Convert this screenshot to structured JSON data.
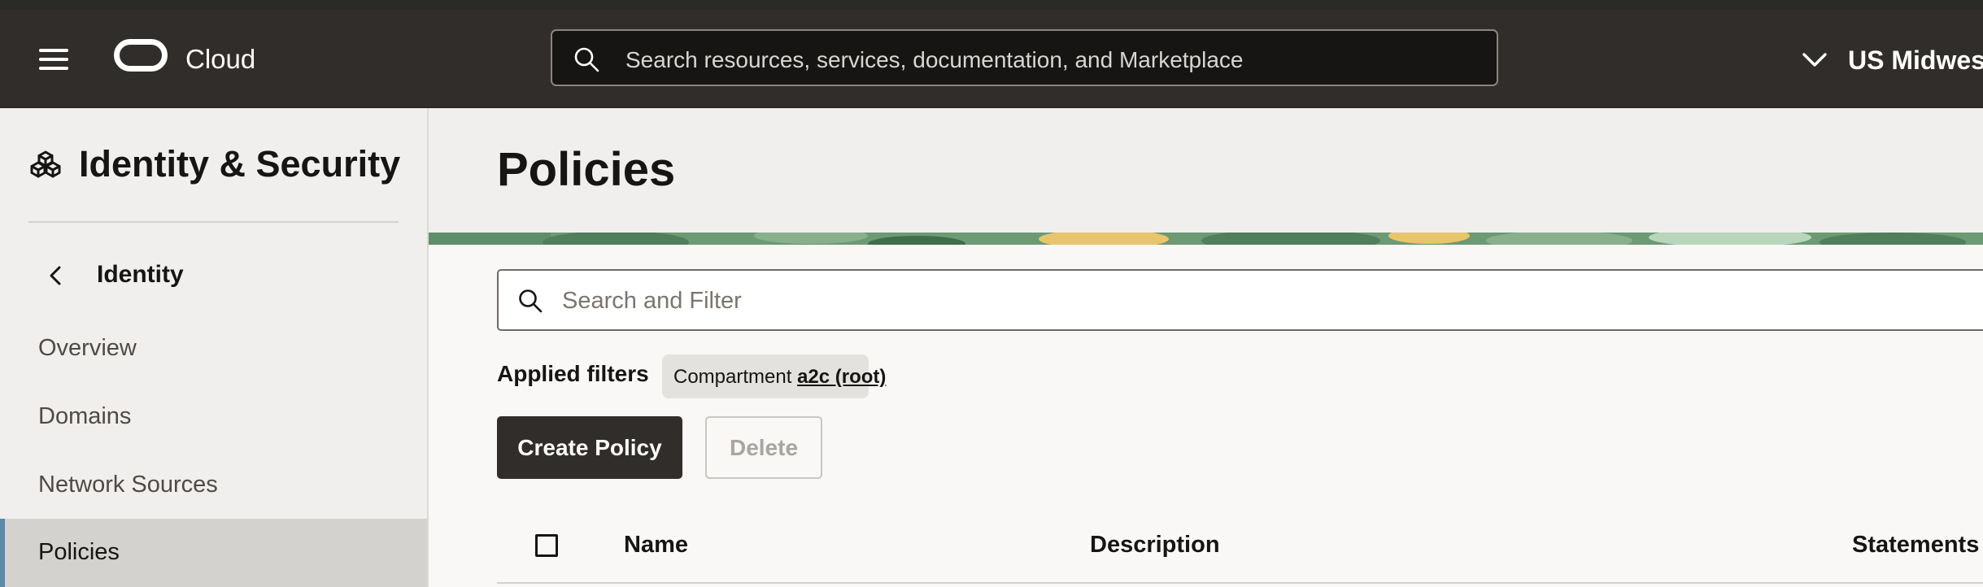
{
  "topbar": {
    "brand": "Cloud",
    "search_placeholder": "Search resources, services, documentation, and Marketplace",
    "region": "US Midwest"
  },
  "sidebar": {
    "title": "Identity & Security",
    "back_label": "Identity",
    "items": [
      {
        "label": "Overview",
        "active": false
      },
      {
        "label": "Domains",
        "active": false
      },
      {
        "label": "Network Sources",
        "active": false
      },
      {
        "label": "Policies",
        "active": true
      }
    ]
  },
  "main": {
    "title": "Policies",
    "filter_placeholder": "Search and Filter",
    "applied_filters_label": "Applied filters",
    "filter_chip": {
      "name": "Compartment",
      "value": "a2c (root)"
    },
    "create_button": "Create Policy",
    "delete_button": "Delete",
    "columns": [
      "Name",
      "Description",
      "Statements"
    ]
  },
  "colors": {
    "topbar_bg": "#312d2a",
    "sidebar_bg": "#f1efed",
    "active_item_bg": "#d4d2cf",
    "active_accent": "#5c8aa8",
    "primary_button": "#312d2a"
  },
  "icons": {
    "menu": "hamburger-icon",
    "logo": "oracle-logo-icon",
    "search": "search-icon",
    "region": "chevron-down-icon",
    "brand": "identity-cubes-icon",
    "back": "chevron-left-icon"
  }
}
